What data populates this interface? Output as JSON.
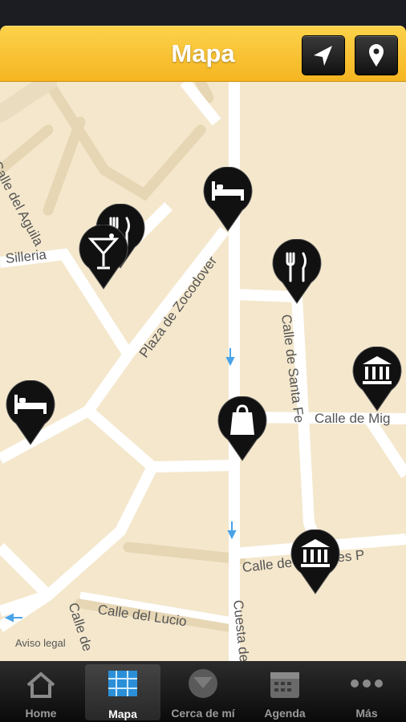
{
  "header": {
    "title": "Mapa",
    "locate_button": "navigation-arrow-icon",
    "pin_button": "map-pin-icon"
  },
  "map": {
    "streets": {
      "del_aguila": "Calle del Aguila",
      "silleria": "Silleria",
      "zocodover": "Plaza de Zocodover",
      "santa_fe": "Calle de Santa Fe",
      "miguel": "Calle de Mig",
      "alfereces": "Calle de Alféreces P",
      "lucio": "Calle del Lucio",
      "cuesta": "Cuesta de",
      "left_lower": "Calle de"
    },
    "aviso_legal": "Aviso legal",
    "pins": [
      "restaurant",
      "cocktail-bar",
      "hotel",
      "restaurant",
      "museum",
      "hotel",
      "shopping",
      "museum"
    ]
  },
  "tabbar": {
    "home": "Home",
    "mapa": "Mapa",
    "cerca": "Cerca de mí",
    "agenda": "Agenda",
    "mas": "Más"
  },
  "colors": {
    "navbar": "#f5b521",
    "map_bg": "#f4e7cc",
    "road": "#ffffff",
    "pin": "#111111"
  }
}
